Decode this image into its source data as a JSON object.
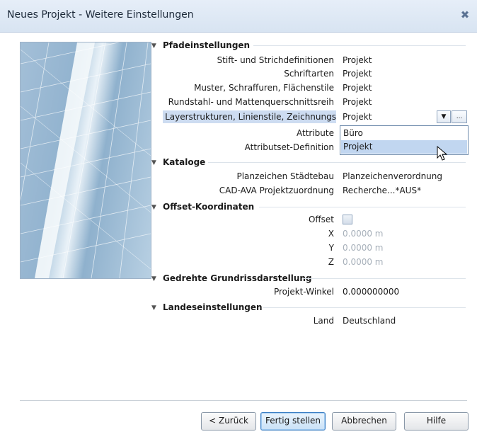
{
  "window": {
    "title": "Neues Projekt - Weitere Einstellungen",
    "close_icon": "close-icon"
  },
  "sections": {
    "pfad": {
      "title": "Pfadeinstellungen",
      "rows": [
        {
          "label": "Stift- und Strichdefinitionen",
          "value": "Projekt"
        },
        {
          "label": "Schriftarten",
          "value": "Projekt"
        },
        {
          "label": "Muster, Schraffuren, Flächenstile",
          "value": "Projekt"
        },
        {
          "label": "Rundstahl- und Mattenquerschnittsreih",
          "value": "Projekt"
        },
        {
          "label": "Layerstrukturen, Linienstile, Zeichnungs",
          "value": "Projekt"
        },
        {
          "label": "Attribute",
          "value": ""
        },
        {
          "label": "Attributset-Definition",
          "value": ""
        }
      ]
    },
    "kataloge": {
      "title": "Kataloge",
      "rows": [
        {
          "label": "Planzeichen Städtebau",
          "value": "Planzeichenverordnung"
        },
        {
          "label": "CAD-AVA Projektzuordnung",
          "value": "Recherche...*AUS*"
        }
      ]
    },
    "offset": {
      "title": "Offset-Koordinaten",
      "rows": [
        {
          "label": "Offset",
          "value": ""
        },
        {
          "label": "X",
          "value": "0.0000 m"
        },
        {
          "label": "Y",
          "value": "0.0000 m"
        },
        {
          "label": "Z",
          "value": "0.0000 m"
        }
      ]
    },
    "gedreht": {
      "title": "Gedrehte Grundrissdarstellung",
      "rows": [
        {
          "label": "Projekt-Winkel",
          "value": "0.000000000"
        }
      ]
    },
    "landes": {
      "title": "Landeseinstellungen",
      "rows": [
        {
          "label": "Land",
          "value": "Deutschland"
        }
      ]
    }
  },
  "dropdown": {
    "options": [
      "Büro",
      "Projekt"
    ],
    "selected": "Projekt",
    "more_button": "..."
  },
  "buttons": {
    "back": "< Zurück",
    "finish": "Fertig stellen",
    "cancel": "Abbrechen",
    "help": "Hilfe"
  },
  "colors": {
    "accent": "#cddcf1",
    "selected_option": "#c1d6f0",
    "disabled_text": "#a7b0ba"
  }
}
